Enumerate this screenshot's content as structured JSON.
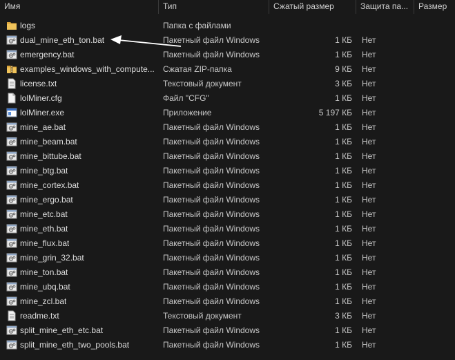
{
  "columns": {
    "name": "Имя",
    "type": "Тип",
    "compressed_size": "Сжатый размер",
    "protection": "Защита па...",
    "size": "Размер"
  },
  "rows": [
    {
      "name": "logs",
      "type": "Папка с файлами",
      "size": "",
      "protection": "",
      "icon": "folder-icon"
    },
    {
      "name": "dual_mine_eth_ton.bat",
      "type": "Пакетный файл Windows",
      "size": "1 КБ",
      "protection": "Нет",
      "icon": "batch-file-icon"
    },
    {
      "name": "emergency.bat",
      "type": "Пакетный файл Windows",
      "size": "1 КБ",
      "protection": "Нет",
      "icon": "batch-file-icon"
    },
    {
      "name": "examples_windows_with_compute...",
      "type": "Сжатая ZIP-папка",
      "size": "9 КБ",
      "protection": "Нет",
      "icon": "zip-folder-icon"
    },
    {
      "name": "license.txt",
      "type": "Текстовый документ",
      "size": "3 КБ",
      "protection": "Нет",
      "icon": "text-file-icon"
    },
    {
      "name": "lolMiner.cfg",
      "type": "Файл \"CFG\"",
      "size": "1 КБ",
      "protection": "Нет",
      "icon": "generic-file-icon"
    },
    {
      "name": "lolMiner.exe",
      "type": "Приложение",
      "size": "5 197 КБ",
      "protection": "Нет",
      "icon": "exe-file-icon"
    },
    {
      "name": "mine_ae.bat",
      "type": "Пакетный файл Windows",
      "size": "1 КБ",
      "protection": "Нет",
      "icon": "batch-file-icon"
    },
    {
      "name": "mine_beam.bat",
      "type": "Пакетный файл Windows",
      "size": "1 КБ",
      "protection": "Нет",
      "icon": "batch-file-icon"
    },
    {
      "name": "mine_bittube.bat",
      "type": "Пакетный файл Windows",
      "size": "1 КБ",
      "protection": "Нет",
      "icon": "batch-file-icon"
    },
    {
      "name": "mine_btg.bat",
      "type": "Пакетный файл Windows",
      "size": "1 КБ",
      "protection": "Нет",
      "icon": "batch-file-icon"
    },
    {
      "name": "mine_cortex.bat",
      "type": "Пакетный файл Windows",
      "size": "1 КБ",
      "protection": "Нет",
      "icon": "batch-file-icon"
    },
    {
      "name": "mine_ergo.bat",
      "type": "Пакетный файл Windows",
      "size": "1 КБ",
      "protection": "Нет",
      "icon": "batch-file-icon"
    },
    {
      "name": "mine_etc.bat",
      "type": "Пакетный файл Windows",
      "size": "1 КБ",
      "protection": "Нет",
      "icon": "batch-file-icon"
    },
    {
      "name": "mine_eth.bat",
      "type": "Пакетный файл Windows",
      "size": "1 КБ",
      "protection": "Нет",
      "icon": "batch-file-icon"
    },
    {
      "name": "mine_flux.bat",
      "type": "Пакетный файл Windows",
      "size": "1 КБ",
      "protection": "Нет",
      "icon": "batch-file-icon"
    },
    {
      "name": "mine_grin_32.bat",
      "type": "Пакетный файл Windows",
      "size": "1 КБ",
      "protection": "Нет",
      "icon": "batch-file-icon"
    },
    {
      "name": "mine_ton.bat",
      "type": "Пакетный файл Windows",
      "size": "1 КБ",
      "protection": "Нет",
      "icon": "batch-file-icon"
    },
    {
      "name": "mine_ubq.bat",
      "type": "Пакетный файл Windows",
      "size": "1 КБ",
      "protection": "Нет",
      "icon": "batch-file-icon"
    },
    {
      "name": "mine_zcl.bat",
      "type": "Пакетный файл Windows",
      "size": "1 КБ",
      "protection": "Нет",
      "icon": "batch-file-icon"
    },
    {
      "name": "readme.txt",
      "type": "Текстовый документ",
      "size": "3 КБ",
      "protection": "Нет",
      "icon": "text-file-icon"
    },
    {
      "name": "split_mine_eth_etc.bat",
      "type": "Пакетный файл Windows",
      "size": "1 КБ",
      "protection": "Нет",
      "icon": "batch-file-icon"
    },
    {
      "name": "split_mine_eth_two_pools.bat",
      "type": "Пакетный файл Windows",
      "size": "1 КБ",
      "protection": "Нет",
      "icon": "batch-file-icon"
    }
  ],
  "colors": {
    "background": "#191919",
    "text": "#dedede",
    "folder": "#e8b64c",
    "arrow": "#ffffff"
  }
}
